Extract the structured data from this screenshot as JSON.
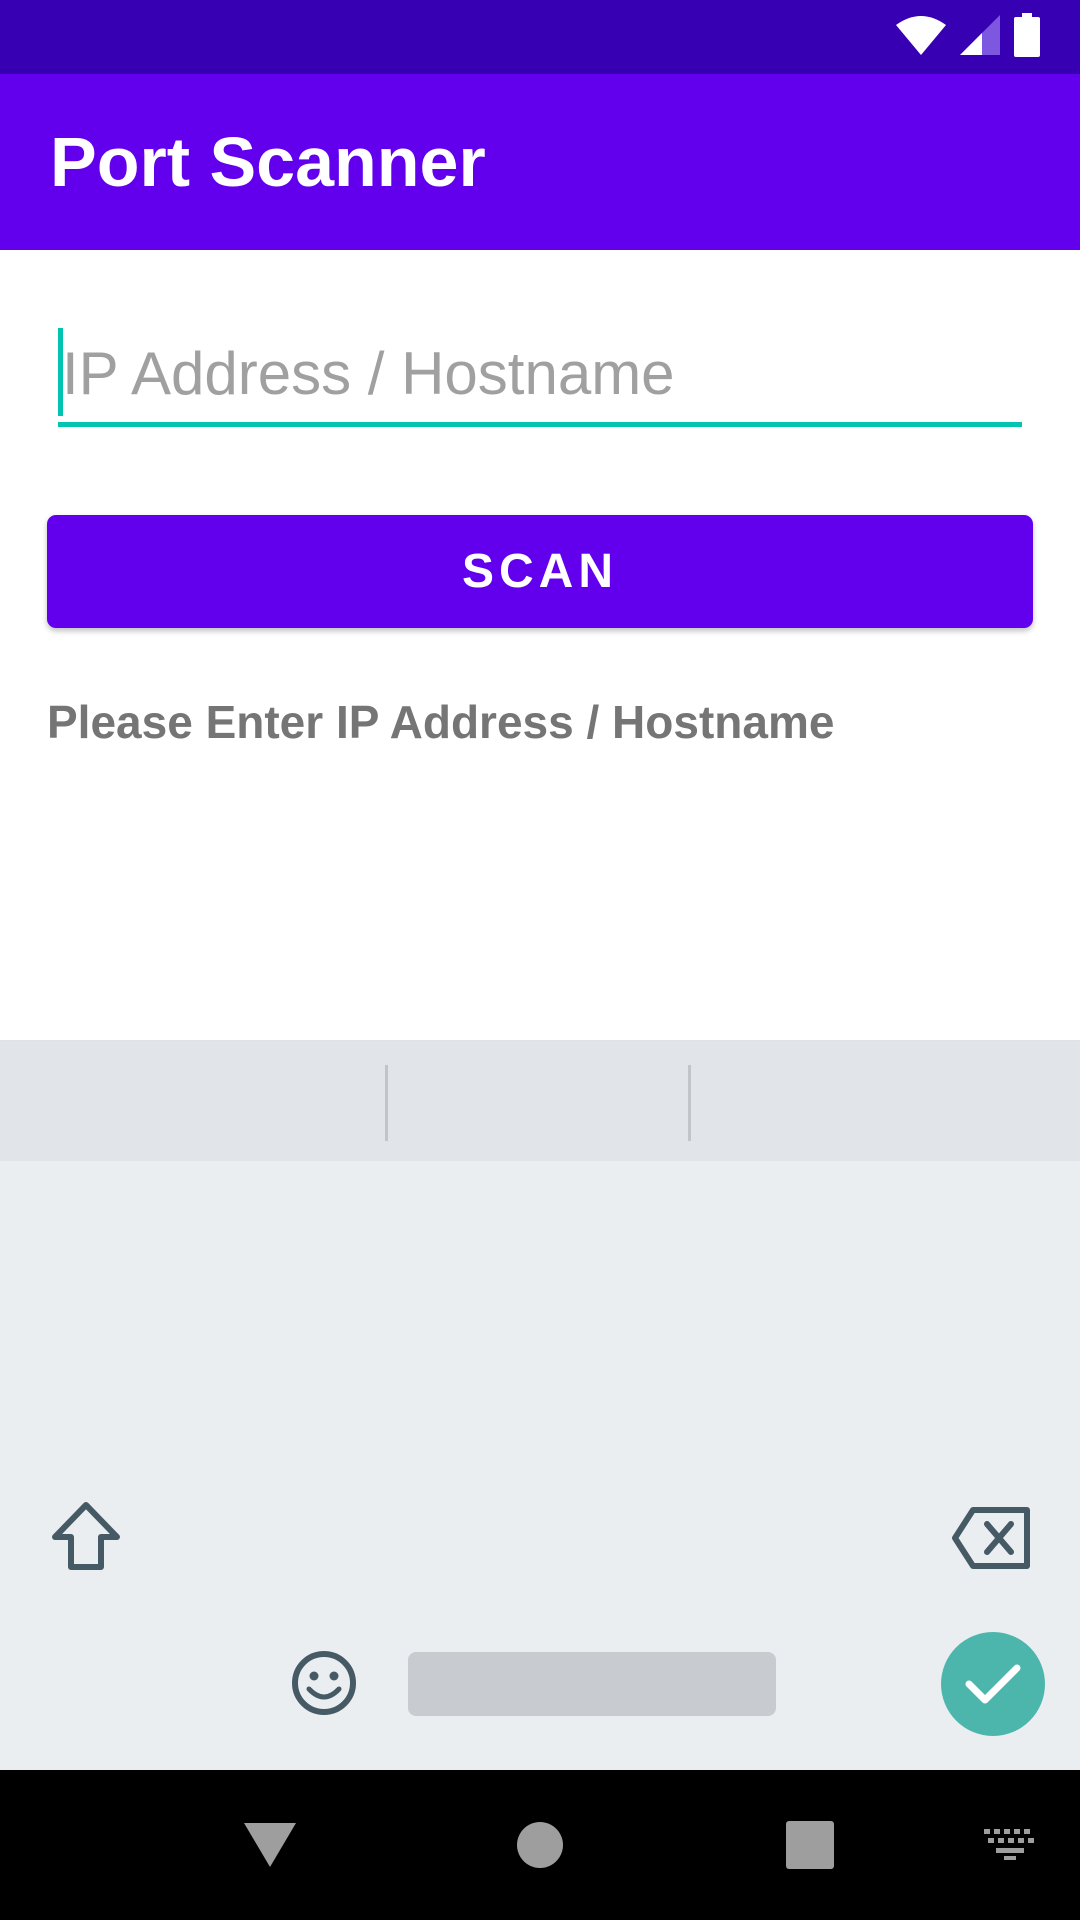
{
  "app": {
    "title": "Port Scanner"
  },
  "form": {
    "ip_placeholder": "IP Address / Hostname",
    "ip_value": "",
    "scan_label": "SCAN",
    "status_message": "Please Enter IP Address / Hostname"
  },
  "status_bar": {
    "icons": [
      "wifi-icon",
      "cell-signal-icon",
      "battery-icon"
    ]
  },
  "keyboard": {
    "keys": [
      "shift-icon",
      "backspace-icon",
      "emoji-icon",
      "spacebar",
      "done-check-icon"
    ]
  },
  "nav_bar": {
    "buttons": [
      "back-icon",
      "home-icon",
      "recents-icon",
      "keyboard-switch-icon"
    ]
  },
  "colors": {
    "status_bar": "#3700b3",
    "primary": "#6200ee",
    "accent": "#03c4b0",
    "keyboard_bg": "#ebeef1",
    "done_key": "#4db6ac"
  }
}
